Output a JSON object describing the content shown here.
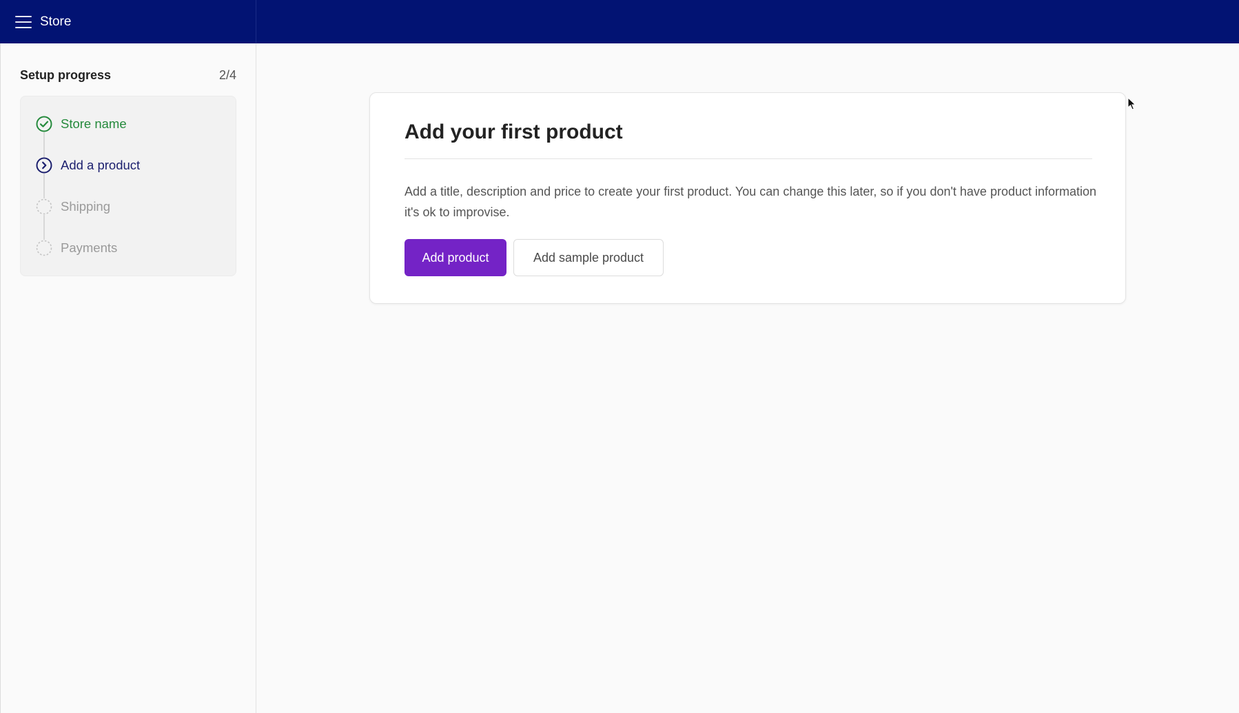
{
  "header": {
    "app_title": "Store",
    "menu_icon": "hamburger-menu-icon",
    "background": "#021373"
  },
  "sidebar": {
    "progress_title": "Setup progress",
    "progress_count": "2/4",
    "steps": [
      {
        "label": "Store name",
        "status": "done",
        "icon": "check-circle-icon"
      },
      {
        "label": "Add a product",
        "status": "active",
        "icon": "chevron-right-circle-icon"
      },
      {
        "label": "Shipping",
        "status": "pending",
        "icon": "dashed-circle-icon"
      },
      {
        "label": "Payments",
        "status": "pending",
        "icon": "dashed-circle-icon"
      }
    ]
  },
  "main": {
    "title": "Add your first product",
    "description": "Add a title, description and price to create your first product. You can change this later, so if you don't have product information it's ok to improvise.",
    "primary_button": "Add product",
    "secondary_button": "Add sample product"
  },
  "colors": {
    "accent": "#7423c6",
    "done": "#258a3c",
    "active": "#1b1f6e",
    "pending": "#9a9a9a"
  }
}
